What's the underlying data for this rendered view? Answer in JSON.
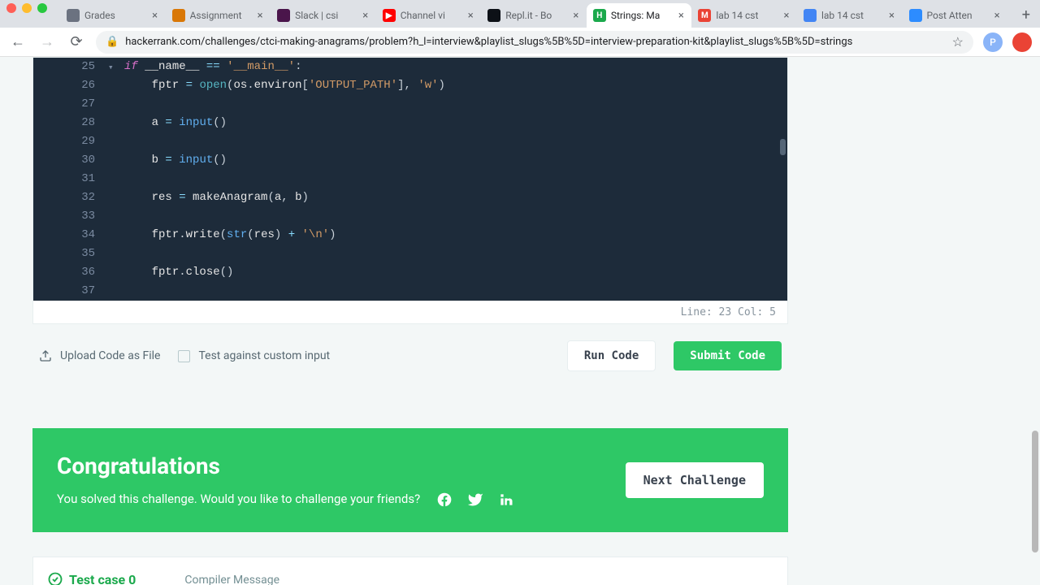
{
  "tabs": [
    {
      "icon_bg": "#6b7280",
      "icon_txt": "",
      "label": "Grades"
    },
    {
      "icon_bg": "#d97706",
      "icon_txt": "",
      "label": "Assignment"
    },
    {
      "icon_bg": "#4a154b",
      "icon_txt": "",
      "label": "Slack | csi"
    },
    {
      "icon_bg": "#ff0000",
      "icon_txt": "▶",
      "label": "Channel vi"
    },
    {
      "icon_bg": "#0d1117",
      "icon_txt": "",
      "label": "Repl.it - Bo"
    },
    {
      "icon_bg": "#1ba94c",
      "icon_txt": "H",
      "label": "Strings: Ma",
      "active": true
    },
    {
      "icon_bg": "#ea4335",
      "icon_txt": "M",
      "label": "lab 14 cst"
    },
    {
      "icon_bg": "#4285f4",
      "icon_txt": "",
      "label": "lab 14 cst"
    },
    {
      "icon_bg": "#2d8cff",
      "icon_txt": "",
      "label": "Post Atten"
    }
  ],
  "url": "hackerrank.com/challenges/ctci-making-anagrams/problem?h_l=interview&playlist_slugs%5B%5D=interview-preparation-kit&playlist_slugs%5B%5D=strings",
  "avatar_letter": "P",
  "code_lines": [
    {
      "n": 25,
      "html": "<span class='kw'>if</span> <span class='var'>__name__</span> <span class='op'>==</span> <span class='str'>'__main__'</span>:"
    },
    {
      "n": 26,
      "html": "    <span class='var'>fptr</span> <span class='op'>=</span> <span class='fn'>open</span>(<span class='var'>os</span>.<span class='var'>environ</span>[<span class='str'>'OUTPUT_PATH'</span>], <span class='str'>'w'</span>)"
    },
    {
      "n": 27,
      "html": ""
    },
    {
      "n": 28,
      "html": "    <span class='var'>a</span> <span class='op'>=</span> <span class='builtin'>input</span>()"
    },
    {
      "n": 29,
      "html": ""
    },
    {
      "n": 30,
      "html": "    <span class='var'>b</span> <span class='op'>=</span> <span class='builtin'>input</span>()"
    },
    {
      "n": 31,
      "html": ""
    },
    {
      "n": 32,
      "html": "    <span class='var'>res</span> <span class='op'>=</span> <span class='var'>makeAnagram</span>(<span class='var'>a</span>, <span class='var'>b</span>)"
    },
    {
      "n": 33,
      "html": ""
    },
    {
      "n": 34,
      "html": "    <span class='var'>fptr</span>.<span class='var'>write</span>(<span class='builtin'>str</span>(<span class='var'>res</span>) <span class='op'>+</span> <span class='str'>'\\n'</span>)"
    },
    {
      "n": 35,
      "html": ""
    },
    {
      "n": 36,
      "html": "    <span class='var'>fptr</span>.<span class='var'>close</span>()"
    },
    {
      "n": 37,
      "html": ""
    }
  ],
  "status_line": "Line: 23 Col: 5",
  "upload_label": "Upload Code as File",
  "custom_input_label": "Test against custom input",
  "run_label": "Run Code",
  "submit_label": "Submit Code",
  "congrats_title": "Congratulations",
  "congrats_text": "You solved this challenge. Would you like to challenge your friends?",
  "next_label": "Next Challenge",
  "testcase_label": "Test case 0",
  "compiler_label": "Compiler Message"
}
